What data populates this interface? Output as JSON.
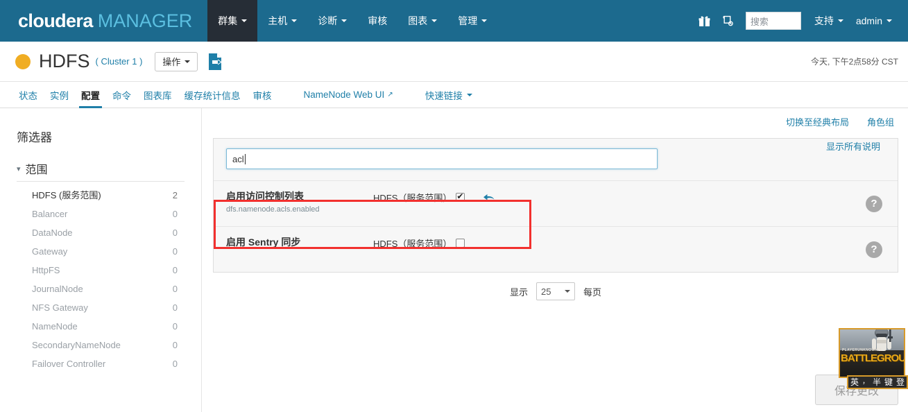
{
  "topnav": {
    "brand_primary": "cloudera",
    "brand_secondary": "MANAGER",
    "menu": [
      {
        "label": "群集",
        "has_caret": true,
        "active": true
      },
      {
        "label": "主机",
        "has_caret": true,
        "active": false
      },
      {
        "label": "诊断",
        "has_caret": true,
        "active": false
      },
      {
        "label": "审核",
        "has_caret": false,
        "active": false
      },
      {
        "label": "图表",
        "has_caret": true,
        "active": false
      },
      {
        "label": "管理",
        "has_caret": true,
        "active": false
      }
    ],
    "gift_icon": "gift-icon",
    "parcel_icon": "parcel-icon",
    "search_placeholder": "搜索",
    "search_value": "",
    "support_label": "支持",
    "user_label": "admin",
    "bar_color": "#1c6a8e",
    "active_tab_color": "#262d36"
  },
  "service_header": {
    "status_color": "#f0ad23",
    "name": "HDFS",
    "cluster": "( Cluster 1 )",
    "actions_label": "操作",
    "export_icon": "export-config-icon",
    "timestamp": "今天, 下午2点58分 CST"
  },
  "tabs": [
    {
      "label": "状态",
      "active": false
    },
    {
      "label": "实例",
      "active": false
    },
    {
      "label": "配置",
      "active": true
    },
    {
      "label": "命令",
      "active": false
    },
    {
      "label": "图表库",
      "active": false
    },
    {
      "label": "缓存统计信息",
      "active": false
    },
    {
      "label": "审核",
      "active": false
    },
    {
      "label": "NameNode Web UI",
      "active": false,
      "external": true
    },
    {
      "label": "快速链接",
      "active": false,
      "caret": true
    }
  ],
  "sidebar": {
    "title": "筛选器",
    "section_label": "范围",
    "items": [
      {
        "label": "HDFS (服务范围)",
        "count": "2",
        "selected": true
      },
      {
        "label": "Balancer",
        "count": "0",
        "selected": false
      },
      {
        "label": "DataNode",
        "count": "0",
        "selected": false
      },
      {
        "label": "Gateway",
        "count": "0",
        "selected": false
      },
      {
        "label": "HttpFS",
        "count": "0",
        "selected": false
      },
      {
        "label": "JournalNode",
        "count": "0",
        "selected": false
      },
      {
        "label": "NFS Gateway",
        "count": "0",
        "selected": false
      },
      {
        "label": "NameNode",
        "count": "0",
        "selected": false
      },
      {
        "label": "SecondaryNameNode",
        "count": "0",
        "selected": false
      },
      {
        "label": "Failover Controller",
        "count": "0",
        "selected": false
      }
    ]
  },
  "content": {
    "switch_layout_link": "切换至经典布局",
    "role_groups_link": "角色组",
    "search_value": "acl",
    "search_placeholder": "",
    "show_all_descriptions": "显示所有说明",
    "config_rows": [
      {
        "title": "启用访问控制列表",
        "key": "dfs.namenode.acls.enabled",
        "scope_label": "HDFS（服务范围）",
        "checked": true,
        "has_revert": true,
        "highlighted": true,
        "help_icon": "help-icon"
      },
      {
        "title": "启用 Sentry 同步",
        "key": "",
        "scope_label": "HDFS（服务范围）",
        "checked": false,
        "has_revert": false,
        "highlighted": false,
        "help_icon": "help-icon"
      }
    ],
    "pagination": {
      "prefix": "显示",
      "value": "25",
      "suffix": "每页"
    },
    "save_button": "保存更改",
    "highlight_color": "#f2302e"
  },
  "overlay_ad": {
    "title_top": "PLAYERUNKNOWN'S",
    "title_main": "BATTLEGROUN",
    "ime_items": [
      "英",
      "，",
      "半",
      "键",
      "登"
    ]
  }
}
